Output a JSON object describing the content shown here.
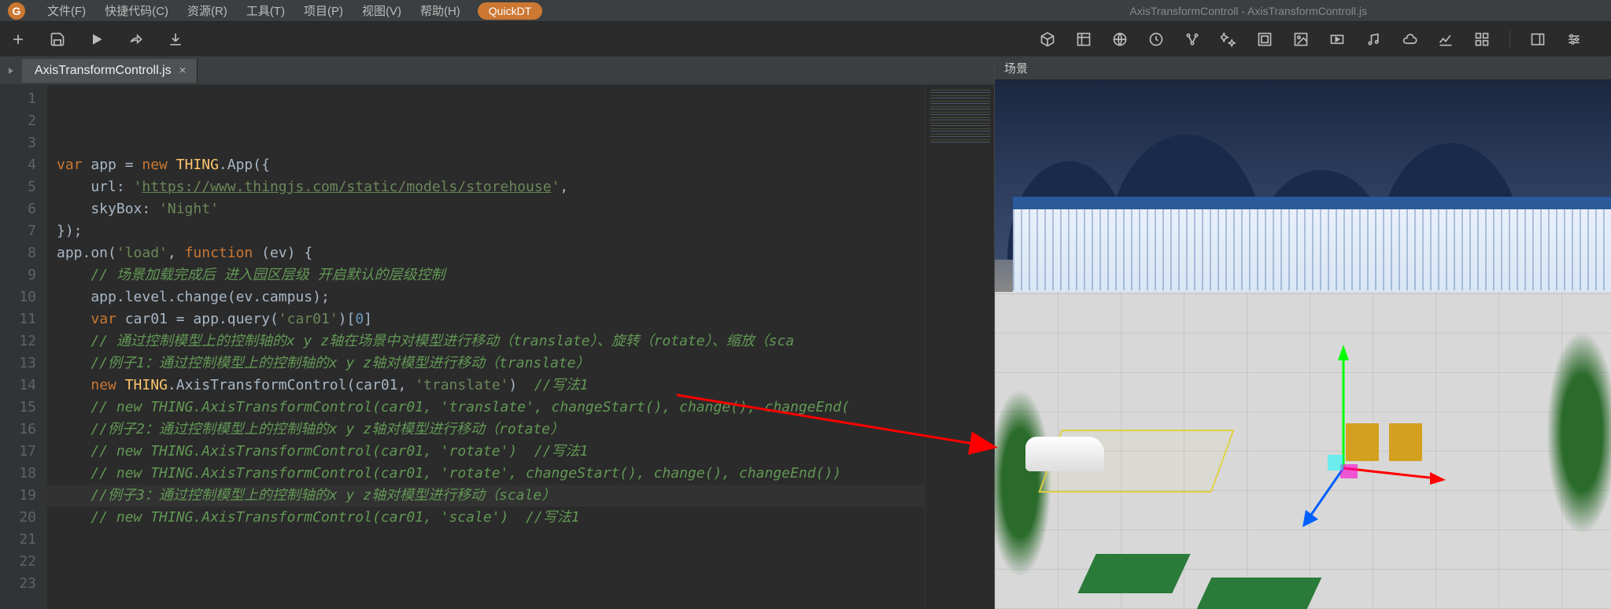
{
  "menubar": {
    "items": [
      "文件(F)",
      "快捷代码(C)",
      "资源(R)",
      "工具(T)",
      "项目(P)",
      "视图(V)",
      "帮助(H)"
    ],
    "quickdt": "QuickDT"
  },
  "title": "AxisTransformControll - AxisTransformControll.js",
  "tab": {
    "label": "AxisTransformControll.js"
  },
  "scene": {
    "header": "场景"
  },
  "code": {
    "lines": [
      {
        "n": 1,
        "segs": [
          {
            "t": "var",
            "c": "kw"
          },
          {
            "t": " app = "
          },
          {
            "t": "new",
            "c": "kw"
          },
          {
            "t": " "
          },
          {
            "t": "THING",
            "c": "cls"
          },
          {
            "t": ".App({"
          }
        ]
      },
      {
        "n": 2,
        "segs": [
          {
            "t": "    url: "
          },
          {
            "t": "'",
            "c": "str"
          },
          {
            "t": "https://www.thingjs.com/static/models/storehouse",
            "c": "str-u"
          },
          {
            "t": "'",
            "c": "str"
          },
          {
            "t": ","
          }
        ]
      },
      {
        "n": 3,
        "segs": [
          {
            "t": "    skyBox: "
          },
          {
            "t": "'Night'",
            "c": "str"
          }
        ]
      },
      {
        "n": 4,
        "segs": [
          {
            "t": "});"
          }
        ]
      },
      {
        "n": 5,
        "segs": [
          {
            "t": ""
          }
        ]
      },
      {
        "n": 6,
        "segs": [
          {
            "t": "app.on("
          },
          {
            "t": "'load'",
            "c": "str"
          },
          {
            "t": ", "
          },
          {
            "t": "function",
            "c": "kw"
          },
          {
            "t": " ("
          },
          {
            "t": "ev"
          },
          {
            "t": ") {"
          }
        ]
      },
      {
        "n": 7,
        "segs": [
          {
            "t": "    "
          },
          {
            "t": "// 场景加载完成后 进入园区层级 开启默认的层级控制",
            "c": "cmt-g"
          }
        ]
      },
      {
        "n": 8,
        "segs": [
          {
            "t": "    app.level.change(ev.campus);"
          }
        ]
      },
      {
        "n": 9,
        "segs": [
          {
            "t": ""
          }
        ]
      },
      {
        "n": 10,
        "segs": [
          {
            "t": "    "
          },
          {
            "t": "var",
            "c": "kw"
          },
          {
            "t": " car01 = app.query("
          },
          {
            "t": "'car01'",
            "c": "str"
          },
          {
            "t": ")["
          },
          {
            "t": "0",
            "c": "num"
          },
          {
            "t": "]"
          }
        ]
      },
      {
        "n": 11,
        "segs": [
          {
            "t": ""
          }
        ]
      },
      {
        "n": 12,
        "segs": [
          {
            "t": "    "
          },
          {
            "t": "// 通过控制模型上的控制轴的x y z轴在场景中对模型进行移动（translate）、旋转（rotate）、缩放（sca",
            "c": "cmt-g"
          }
        ]
      },
      {
        "n": 13,
        "segs": [
          {
            "t": ""
          }
        ]
      },
      {
        "n": 14,
        "segs": [
          {
            "t": "    "
          },
          {
            "t": "//例子1：通过控制模型上的控制轴的x y z轴对模型进行移动（translate）",
            "c": "cmt-g"
          }
        ]
      },
      {
        "n": 15,
        "segs": [
          {
            "t": "    "
          },
          {
            "t": "new",
            "c": "kw"
          },
          {
            "t": " "
          },
          {
            "t": "THING",
            "c": "cls"
          },
          {
            "t": ".AxisTransformControl(car01, "
          },
          {
            "t": "'translate'",
            "c": "str"
          },
          {
            "t": ")  "
          },
          {
            "t": "//写法1",
            "c": "cmt-g"
          }
        ]
      },
      {
        "n": 16,
        "segs": [
          {
            "t": "    "
          },
          {
            "t": "// new THING.AxisTransformControl(car01, 'translate', changeStart(), change(), changeEnd(",
            "c": "cmt-g"
          }
        ]
      },
      {
        "n": 17,
        "segs": [
          {
            "t": ""
          }
        ]
      },
      {
        "n": 18,
        "segs": [
          {
            "t": "    "
          },
          {
            "t": "//例子2：通过控制模型上的控制轴的x y z轴对模型进行移动（rotate）",
            "c": "cmt-g"
          }
        ]
      },
      {
        "n": 19,
        "segs": [
          {
            "t": "    "
          },
          {
            "t": "// new THING.AxisTransformControl(car01, 'rotate')  //写法1",
            "c": "cmt-g"
          }
        ]
      },
      {
        "n": 20,
        "segs": [
          {
            "t": "    "
          },
          {
            "t": "// new THING.AxisTransformControl(car01, 'rotate', changeStart(), change(), changeEnd())",
            "c": "cmt-g"
          }
        ]
      },
      {
        "n": 21,
        "segs": [
          {
            "t": ""
          }
        ]
      },
      {
        "n": 22,
        "segs": [
          {
            "t": "    "
          },
          {
            "t": "//例子3：通过控制模型上的控制轴的x y z轴对模型进行移动（scale）",
            "c": "cmt-g"
          }
        ]
      },
      {
        "n": 23,
        "segs": [
          {
            "t": "    "
          },
          {
            "t": "// new THING.AxisTransformControl(car01, 'scale')  //写法1",
            "c": "cmt-g"
          }
        ]
      }
    ]
  }
}
